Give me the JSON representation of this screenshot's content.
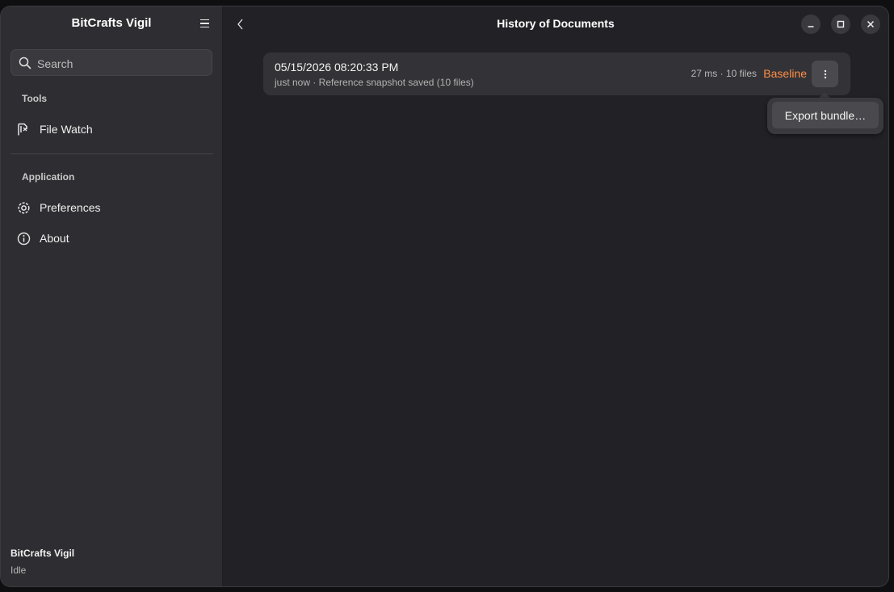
{
  "sidebar": {
    "title": "BitCrafts Vigil",
    "search_placeholder": "Search",
    "sections": [
      {
        "label": "Tools",
        "items": [
          {
            "label": "File Watch",
            "icon": "file-watch-icon"
          }
        ]
      },
      {
        "label": "Application",
        "items": [
          {
            "label": "Preferences",
            "icon": "gear-icon"
          },
          {
            "label": "About",
            "icon": "info-icon"
          }
        ]
      }
    ],
    "footer": {
      "app_name": "BitCrafts Vigil",
      "status": "Idle"
    }
  },
  "header": {
    "title": "History of Documents"
  },
  "history": [
    {
      "date": "05/15/2026 08:20:33 PM",
      "subtitle": "just now · Reference snapshot saved (10 files)",
      "meta": "27 ms · 10 files",
      "badge": "Baseline"
    }
  ],
  "menu": {
    "items": [
      "Export bundle…"
    ]
  },
  "colors": {
    "accent": "#ff8d45",
    "sidebar_bg": "#2e2e32",
    "content_bg": "#222226"
  }
}
